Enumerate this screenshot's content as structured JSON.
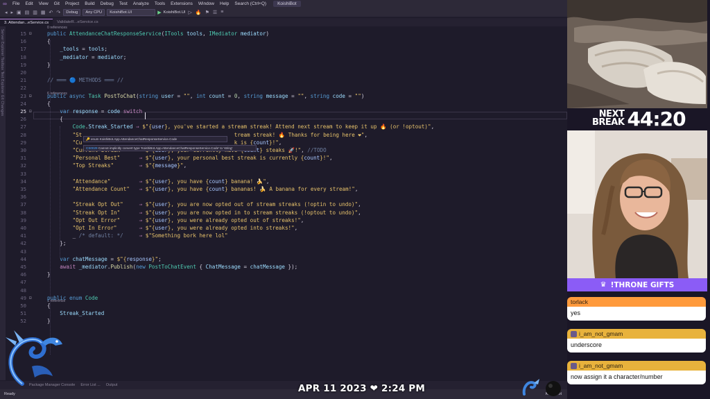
{
  "menu": {
    "items": [
      "File",
      "Edit",
      "View",
      "Git",
      "Project",
      "Build",
      "Debug",
      "Test",
      "Analyze",
      "Tools",
      "Extensions",
      "Window",
      "Help"
    ],
    "search": "Search (Ctrl+Q)",
    "app_name": "KoishiBot"
  },
  "toolbar": {
    "config": "Debug",
    "platform": "Any CPU",
    "startup_project": "KoishiBot.UI",
    "run_target": "KoishiBot.UI"
  },
  "tabs": [
    {
      "label": "3. Attendan...eService.cs",
      "active": true
    },
    {
      "label": "ValidateR...eService.cs",
      "active": false
    }
  ],
  "left_strip": "Server Explorer  Toolbox  Test Explorer  Git Changes",
  "code": {
    "lens_top": "0 references",
    "lens_23": "6 references",
    "lens_43": "1 reference",
    "lines": [
      {
        "n": "15",
        "html": "<span class='kw'>public</span> <span class='ty'>AttendanceChatResponseService</span>(<span class='ty'>ITools</span> <span class='pm'>tools</span>, <span class='ty'>IMediator</span> <span class='pm'>mediator</span>)"
      },
      {
        "n": "16",
        "html": "{"
      },
      {
        "n": "17",
        "html": "    <span class='pm'>_tools</span> = <span class='pm'>tools</span>;"
      },
      {
        "n": "18",
        "html": "    <span class='pm'>_mediator</span> = <span class='pm'>mediator</span>;"
      },
      {
        "n": "19",
        "html": "}"
      },
      {
        "n": "20",
        "html": ""
      },
      {
        "n": "21",
        "html": "<span class='cm'>// ═══ 🔵 METHODS ═══ //</span>"
      },
      {
        "n": "22",
        "html": ""
      },
      {
        "n": "23",
        "html": "<span class='kw'>public</span> <span class='kw'>async</span> <span class='ty'>Task</span> <span class='fn'>PostToChat</span>(<span class='kw'>string</span> <span class='pm'>user</span> = <span class='st'>\"\"</span>, <span class='kw'>int</span> <span class='pm'>count</span> = <span class='nm'>0</span>, <span class='kw'>string</span> <span class='pm'>message</span> = <span class='st'>\"\"</span>, <span class='kw'>string</span> <span class='pm'>code</span> = <span class='st'>\"\"</span>)"
      },
      {
        "n": "24",
        "html": "{"
      },
      {
        "n": "25",
        "html": "    <span class='kw'>var</span> <span class='pm'>response</span> = <span class='pm'>code</span> <span class='kp'>switch</span>"
      },
      {
        "n": "26",
        "html": "    {"
      },
      {
        "n": "27",
        "html": "        <span class='ty'>Code</span>.<span class='pm'>Streak_Started</span> <span class='kp'>⇒</span> <span class='st'>$\"{</span><span class='ip'>user</span><span class='st'>}, you've started a stream streak! Attend next stream to keep it up 🔥 (or !optout)\"</span>,"
      },
      {
        "n": "28",
        "html": "        <span class='st'>\"St</span>                                                <span class='st'>tream streak! 🔥 Thanks for being here ❤\"</span>,"
      },
      {
        "n": "29",
        "html": "        <span class='st'>\"Cu</span>                                                <span class='st'>k is {</span><span class='ip'>count</span><span class='st'>}!\"</span>,"
      },
      {
        "n": "30",
        "html": "        <span class='st'>\"Current Streak\"</span>     <span class='kp'>⇒</span> <span class='st'>$\"{</span><span class='ip'>user</span><span class='st'>}, your currently have {</span><span class='ip'>count</span><span class='st'>} steaks 🚀!\"</span>, <span class='cm'>//TODO</span>"
      },
      {
        "n": "31",
        "html": "        <span class='st'>\"Personal Best\"</span>      <span class='kp'>⇒</span> <span class='st'>$\"{</span><span class='ip'>user</span><span class='st'>}, your personal best streak is currently {</span><span class='ip'>count</span><span class='st'>}!\"</span>,"
      },
      {
        "n": "32",
        "html": "        <span class='st'>\"Top Streaks\"</span>        <span class='kp'>⇒</span> <span class='st'>$\"{</span><span class='ip'>message</span><span class='st'>}\"</span>,"
      },
      {
        "n": "33",
        "html": ""
      },
      {
        "n": "34",
        "html": "        <span class='st'>\"Attendance\"</span>         <span class='kp'>⇒</span> <span class='st'>$\"{</span><span class='ip'>user</span><span class='st'>}, you have {</span><span class='ip'>count</span><span class='st'>} banana! 🍌\"</span>,"
      },
      {
        "n": "35",
        "html": "        <span class='st'>\"Attendance Count\"</span>   <span class='kp'>⇒</span> <span class='st'>$\"{</span><span class='ip'>user</span><span class='st'>}, you have {</span><span class='ip'>count</span><span class='st'>} bananas! 🍌 A banana for every stream!\"</span>,"
      },
      {
        "n": "36",
        "html": ""
      },
      {
        "n": "37",
        "html": "        <span class='st'>\"Streak Opt Out\"</span>     <span class='kp'>⇒</span> <span class='st'>$\"{</span><span class='ip'>user</span><span class='st'>}, you are now opted out of stream streaks (!optin to undo)\"</span>,"
      },
      {
        "n": "38",
        "html": "        <span class='st'>\"Streak Opt In\"</span>      <span class='kp'>⇒</span> <span class='st'>$\"{</span><span class='ip'>user</span><span class='st'>}, you are now opted in to stream streaks (!optout to undo)\"</span>,"
      },
      {
        "n": "39",
        "html": "        <span class='st'>\"Opt Out Error\"</span>      <span class='kp'>⇒</span> <span class='st'>$\"{</span><span class='ip'>user</span><span class='st'>}, you were already opted out of streaks!\"</span>,"
      },
      {
        "n": "40",
        "html": "        <span class='st'>\"Opt In Error\"</span>       <span class='kp'>⇒</span> <span class='st'>$\"{</span><span class='ip'>user</span><span class='st'>}, you were already opted into streaks!\"</span>,"
      },
      {
        "n": "41",
        "html": "        <span class='pu'>_</span> <span class='cm'>/* default: */</span>     <span class='kp'>⇒</span> <span class='st'>$\"Something bork here lol\"</span>"
      },
      {
        "n": "42",
        "html": "    };"
      },
      {
        "n": "43",
        "html": ""
      },
      {
        "n": "44",
        "html": "    <span class='kw'>var</span> <span class='pm'>chatMessage</span> = <span class='st'>$\"{</span><span class='ip'>response</span><span class='st'>}\"</span>;"
      },
      {
        "n": "45",
        "html": "    <span class='kp'>await</span> <span class='pm'>_mediator</span>.<span class='fn'>Publish</span>(<span class='kw'>new</span> <span class='ty'>PostToChatEvent</span> { <span class='pm'>ChatMessage</span> = <span class='pm'>chatMessage</span> });"
      },
      {
        "n": "46",
        "html": "}"
      },
      {
        "n": "47",
        "html": ""
      },
      {
        "n": "48",
        "html": ""
      },
      {
        "n": "49",
        "html": "<span class='kw'>public</span> <span class='kw'>enum</span> <span class='ty'>Code</span>"
      },
      {
        "n": "50",
        "html": "{"
      },
      {
        "n": "51",
        "html": "    <span class='pm'>Streak_Started</span>"
      },
      {
        "n": "52",
        "html": "}"
      }
    ],
    "tooltip_enum": "🔑 enum KoishiBot.App.AttendanceChatResponseService.Code",
    "tooltip_error_code": "CS0029",
    "tooltip_error_text": "Cannot implicitly convert type 'KoishiBot.App.AttendanceChatResponseService.Code' to 'string'"
  },
  "bottom_tabs": [
    "Package Manager Console",
    "Error List ...",
    "Output"
  ],
  "status": {
    "left": "Ready",
    "right": "KoishiBot"
  },
  "overlay": {
    "date": "APR 11 2023",
    "heart": "❤",
    "time": "2:24 PM",
    "next_break_label_1": "NEXT",
    "next_break_label_2": "BREAK",
    "next_break_timer": "44:20",
    "throne": "!THRONE GIFTS"
  },
  "chat": [
    {
      "user": "torlack",
      "message": "yes",
      "color": "#ff9a3c"
    },
    {
      "user": "i_am_not_gmam",
      "message": "underscore",
      "color": "#e8b23c"
    },
    {
      "user": "i_am_not_gmam",
      "message": "now assign it a character/number",
      "color": "#e8b23c"
    }
  ],
  "colors": {
    "accent": "#8b5cf6",
    "editor_bg": "#1e1b2a"
  }
}
